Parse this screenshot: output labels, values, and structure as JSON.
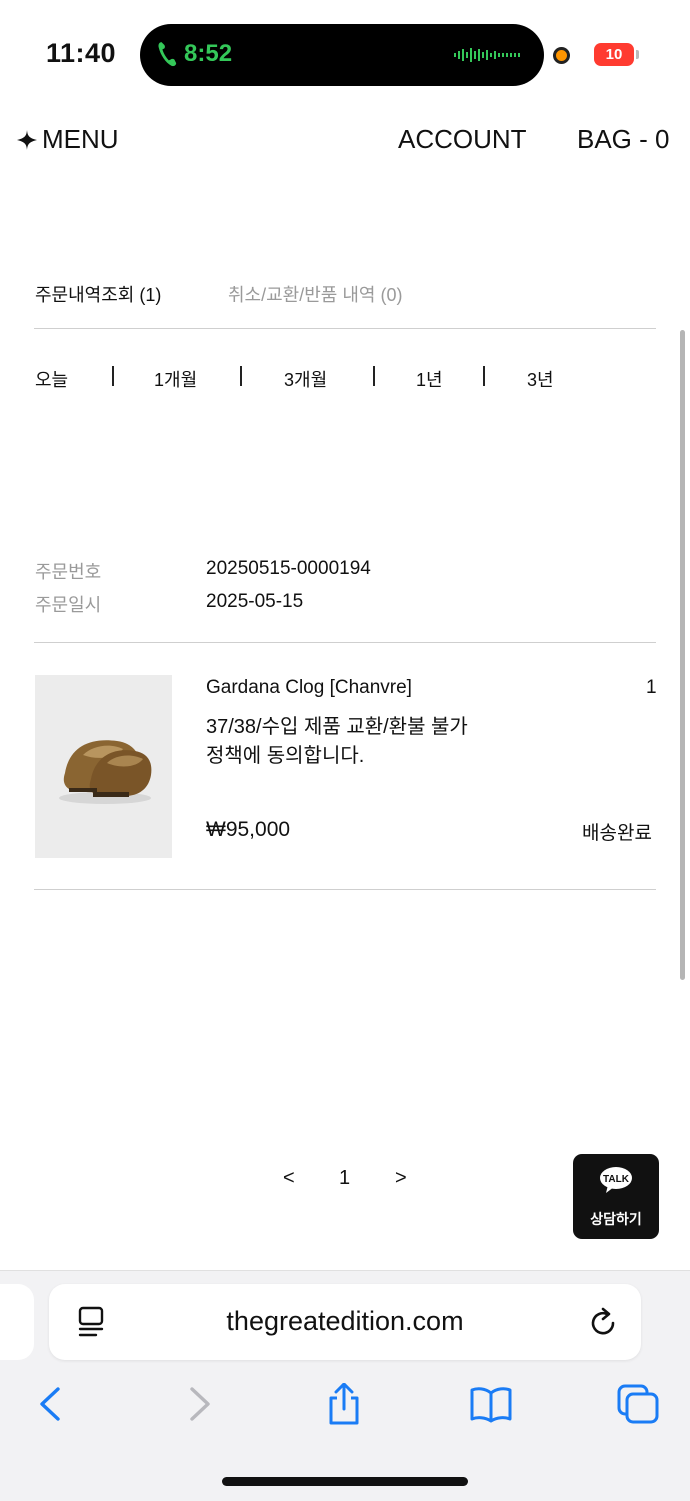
{
  "status_bar": {
    "time": "11:40",
    "call_time": "8:52",
    "battery": "10"
  },
  "header": {
    "menu_label": "MENU",
    "menu_icon": "star-icon",
    "account_label": "ACCOUNT",
    "bag_label": "BAG - 0"
  },
  "tabs": {
    "orders": "주문내역조회 (1)",
    "returns": "취소/교환/반품 내역 (0)"
  },
  "periods": [
    "오늘",
    "1개월",
    "3개월",
    "1년",
    "3년"
  ],
  "order": {
    "number_label": "주문번호",
    "number": "20250515-0000194",
    "date_label": "주문일시",
    "date": "2025-05-15"
  },
  "product": {
    "name": "Gardana Clog [Chanvre]",
    "quantity": "1",
    "option_line1": "37/38/수입 제품 교환/환불 불가",
    "option_line2": "정책에 동의합니다.",
    "price": "₩95,000",
    "status": "배송완료"
  },
  "pagination": {
    "prev": "<",
    "current": "1",
    "next": ">"
  },
  "talk": {
    "bubble_text": "TALK",
    "label": "상담하기"
  },
  "browser": {
    "url": "thegreatedition.com"
  },
  "colors": {
    "call_green": "#34c759",
    "safari_blue": "#1a7cf5",
    "battery_red": "#ff3b30"
  }
}
